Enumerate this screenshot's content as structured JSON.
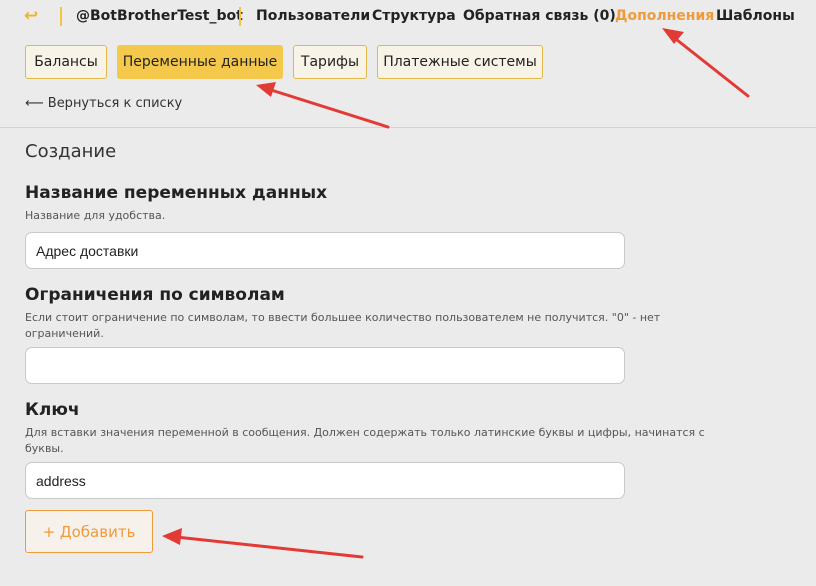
{
  "topnav": {
    "back_icon": "back-arrow-icon",
    "bot_name": "@BotBrotherTest_bot",
    "items": [
      {
        "label": "Пользователи"
      },
      {
        "label": "Структура"
      },
      {
        "label": "Обратная связь (0)"
      },
      {
        "label": "Дополнения"
      },
      {
        "label": "Шаблоны"
      }
    ],
    "active_color": "#ef9a3c",
    "separator_color": "#f3c63f"
  },
  "subtabs": [
    {
      "label": "Балансы"
    },
    {
      "label": "Переменные данные"
    },
    {
      "label": "Тарифы"
    },
    {
      "label": "Платежные системы"
    }
  ],
  "backlink": "⟵ Вернуться к списку",
  "form": {
    "title": "Создание",
    "fields": [
      {
        "label": "Название переменных данных",
        "hint": "Название для удобства.",
        "value": ""
      },
      {
        "label": "Ограничения по символам",
        "hint": "Если стоит ограничение по символам, то ввести большее количество пользователем не получится. \"0\" - нет ограничений.",
        "value": ""
      },
      {
        "label": "Ключ",
        "hint": "Для вставки значения переменной в сообщения. Должен содержать только латинские буквы и цифры, начинатся с буквы.",
        "value": "address"
      }
    ],
    "first_value": "Адрес доставки",
    "add_label": "+ Добавить"
  },
  "colors": {
    "accent": "#f4c84b",
    "orange": "#ef9a3c",
    "annotation_arrow": "#e23a34"
  }
}
